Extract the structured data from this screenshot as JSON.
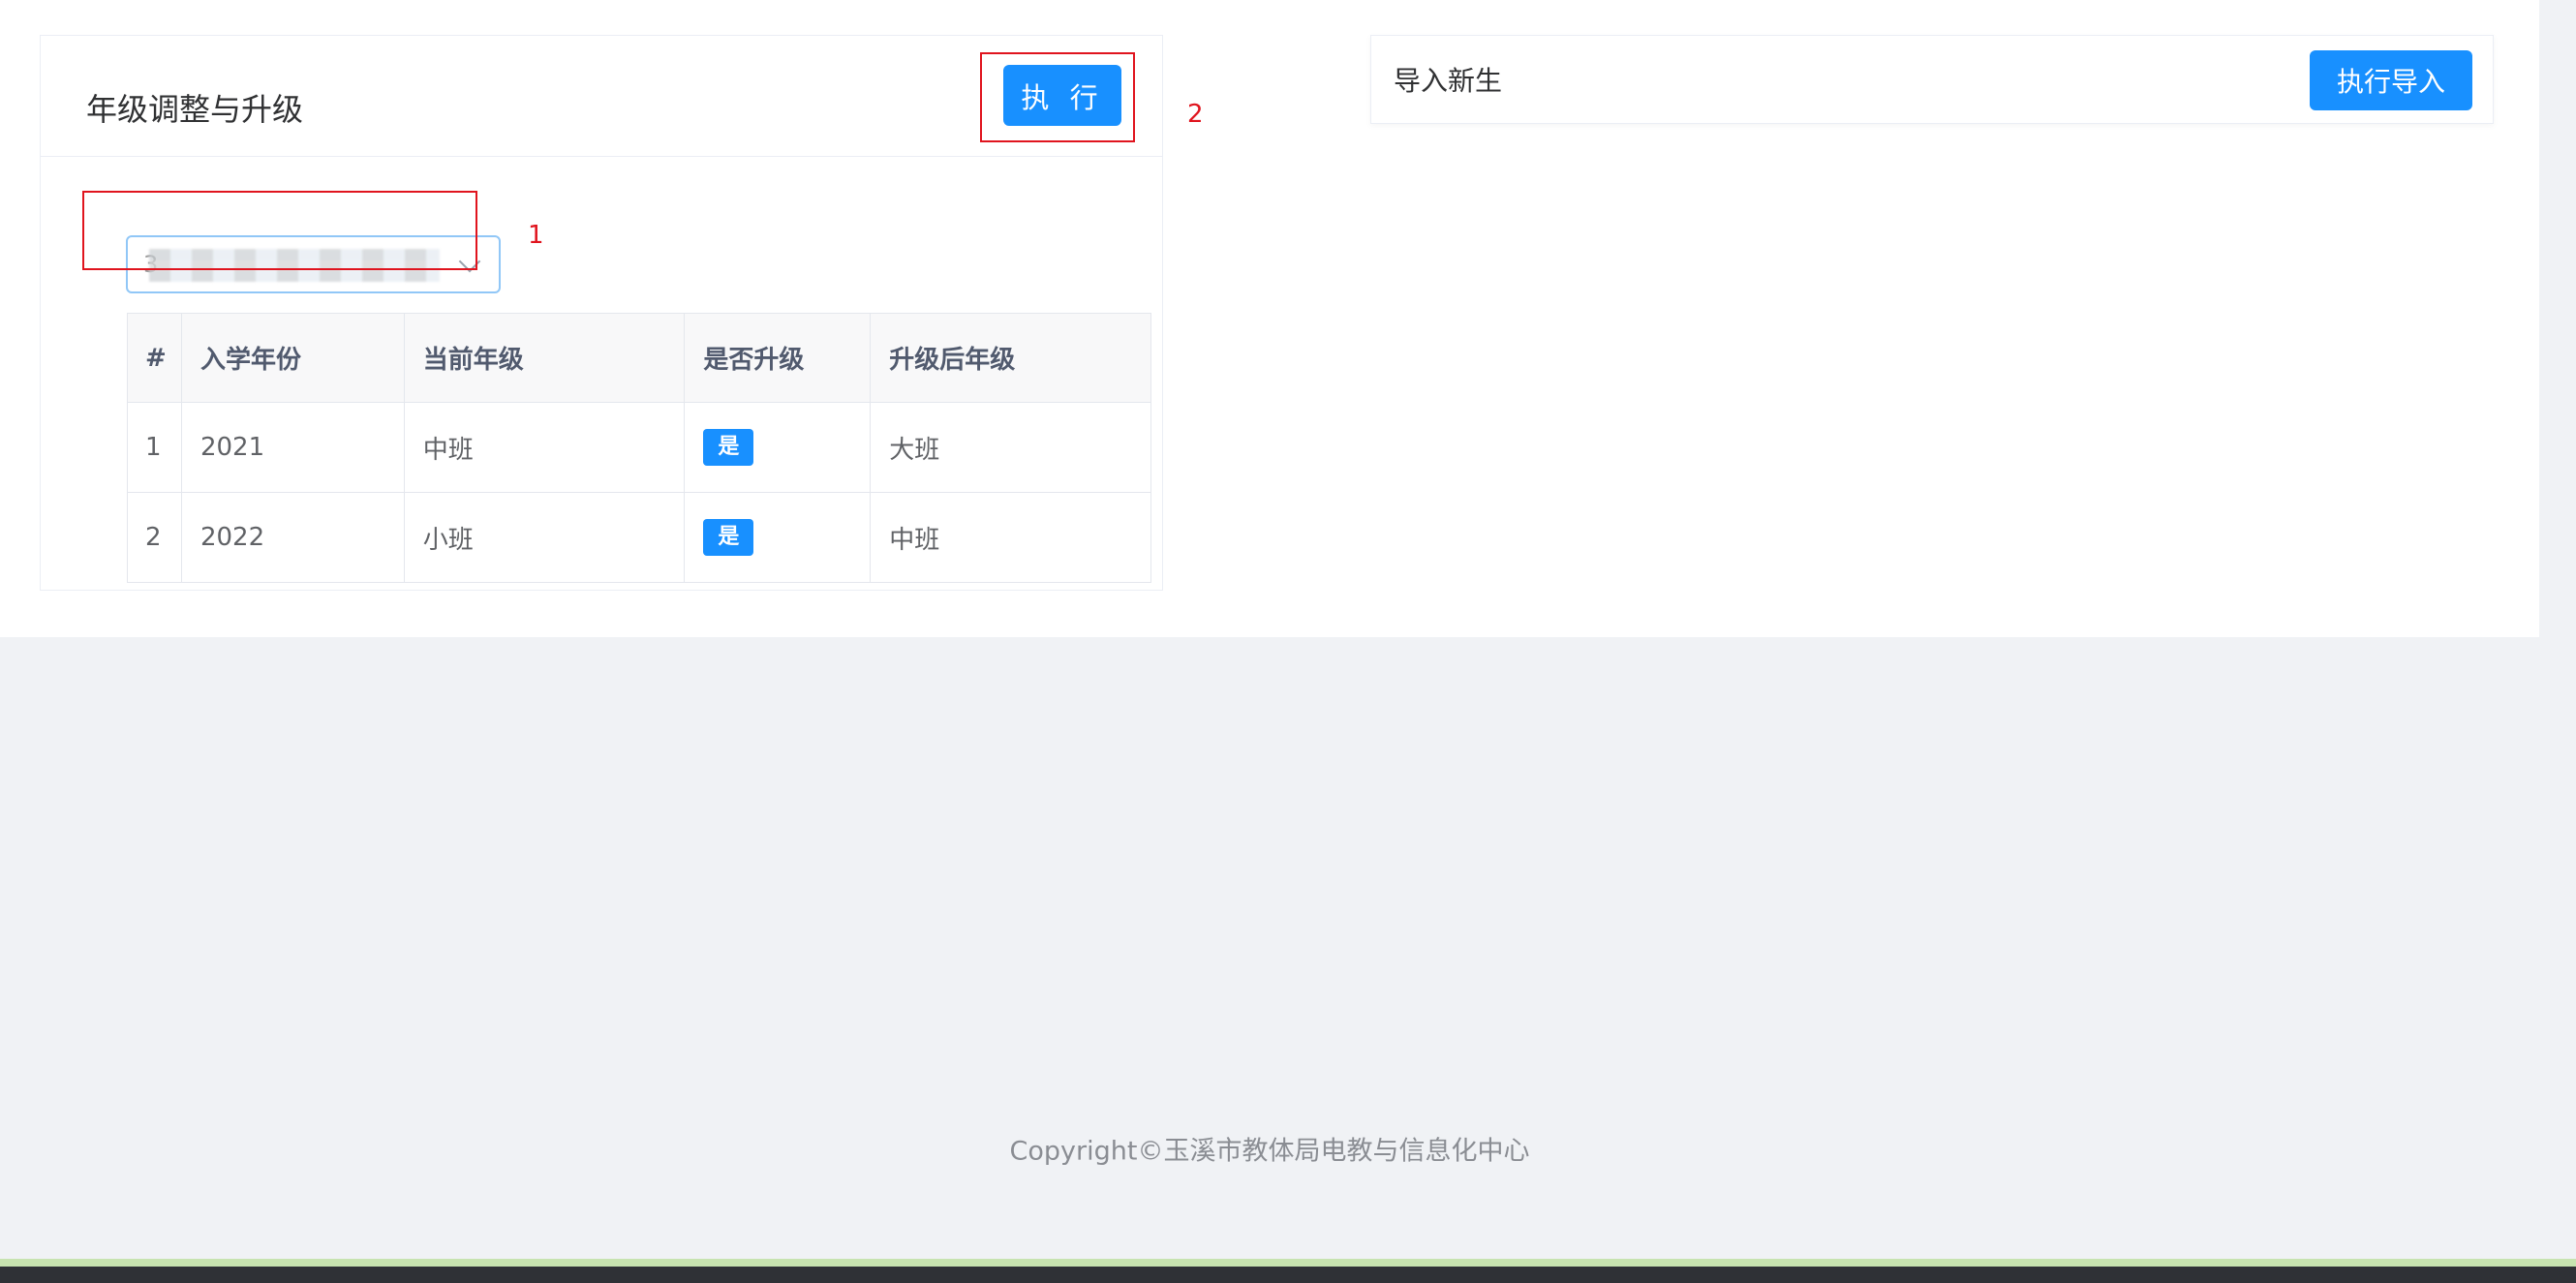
{
  "grade_card": {
    "title": "年级调整与升级",
    "execute_label": "执 行",
    "select": {
      "value": "3"
    },
    "table": {
      "headers": [
        "#",
        "入学年份",
        "当前年级",
        "是否升级",
        "升级后年级"
      ],
      "rows": [
        {
          "index": "1",
          "year": "2021",
          "current": "中班",
          "upgrade": "是",
          "after": "大班"
        },
        {
          "index": "2",
          "year": "2022",
          "current": "小班",
          "upgrade": "是",
          "after": "中班"
        }
      ]
    }
  },
  "annotations": [
    {
      "label": "1"
    },
    {
      "label": "2"
    }
  ],
  "import_card": {
    "title": "导入新生",
    "button_label": "执行导入"
  },
  "footer": {
    "copyright": "Copyright©玉溪市教体局电教与信息化中心"
  },
  "colors": {
    "primary": "#1890ff",
    "annotation": "#e0141e",
    "page_background": "#f0f2f5"
  }
}
